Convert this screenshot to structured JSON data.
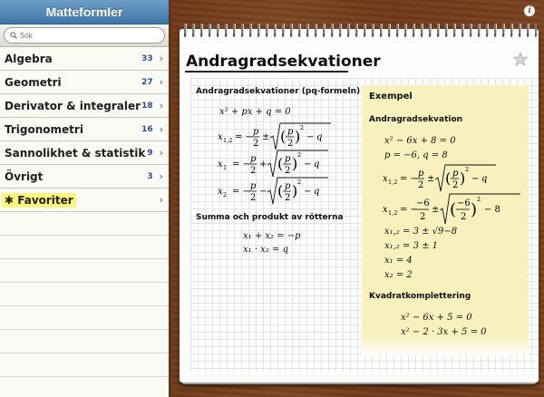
{
  "sidebar": {
    "title": "Matteformler",
    "search": {
      "placeholder": "Sök",
      "value": ""
    },
    "items": [
      {
        "label": "Algebra",
        "count": "33"
      },
      {
        "label": "Geometri",
        "count": "27"
      },
      {
        "label": "Derivator & integraler",
        "count": "18"
      },
      {
        "label": "Trigonometri",
        "count": "16"
      },
      {
        "label": "Sannolikhet & statistik",
        "count": "9"
      },
      {
        "label": "Övrigt",
        "count": "3"
      }
    ],
    "favorites": {
      "label": "Favoriter",
      "icon": "asterisk-icon"
    },
    "chevron": "›",
    "accent": "#3f76a8",
    "count_color": "#2e4f9e",
    "favorites_highlight": "#fbf57c"
  },
  "page": {
    "title": "Andragradsekvationer",
    "left": {
      "heading1": "Andragradsekvationer (pq-formeln)",
      "eq1": "x² + px + q = 0",
      "heading2": "Summa och produkt av rötterna",
      "sum": "x₁ + x₂ = −p",
      "product": "x₁ · x₂ = q"
    },
    "example": {
      "heading": "Exempel",
      "subheading1": "Andragradsekvation",
      "e1": "x² − 6x + 8 = 0",
      "e2": "p = −6, q = 8",
      "e5": "x₁,₂ = 3 ± √9−8",
      "e6": "x₁,₂ = 3 ± 1",
      "e7": "x₁ = 4",
      "e8": "x₂ = 2",
      "subheading2": "Kvadratkomplettering",
      "k1": "x² − 6x + 5 = 0",
      "k2": "x² − 2 · 3x + 5 = 0",
      "background": "#f9f1bd"
    }
  },
  "wood_color": "#7a4220",
  "info_icon": "info-icon",
  "star_icon": "star-icon"
}
